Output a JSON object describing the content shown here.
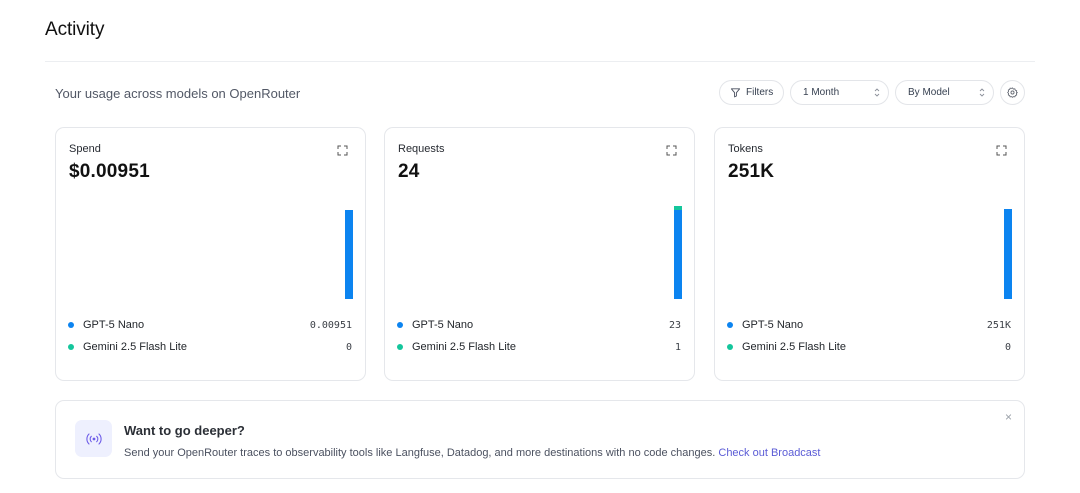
{
  "header": {
    "title": "Activity"
  },
  "subtitle": "Your usage across models on OpenRouter",
  "toolbar": {
    "filters_label": "Filters",
    "period_value": "1 Month",
    "group_value": "By Model"
  },
  "legend_colors": {
    "gpt5_nano": "#0c84f0",
    "gemini_flash_lite": "#14c69c"
  },
  "cards": [
    {
      "label": "Spend",
      "value": "$0.00951",
      "rows": [
        {
          "name": "GPT-5 Nano",
          "value": "0.00951"
        },
        {
          "name": "Gemini 2.5 Flash Lite",
          "value": "0"
        }
      ]
    },
    {
      "label": "Requests",
      "value": "24",
      "rows": [
        {
          "name": "GPT-5 Nano",
          "value": "23"
        },
        {
          "name": "Gemini 2.5 Flash Lite",
          "value": "1"
        }
      ]
    },
    {
      "label": "Tokens",
      "value": "251K",
      "rows": [
        {
          "name": "GPT-5 Nano",
          "value": "251K"
        },
        {
          "name": "Gemini 2.5 Flash Lite",
          "value": "0"
        }
      ]
    }
  ],
  "banner": {
    "heading": "Want to go deeper?",
    "text": "Send your OpenRouter traces to observability tools like Langfuse, Datadog, and more destinations with no code changes.",
    "link": "Check out Broadcast",
    "close": "×"
  },
  "icons": {
    "filter": "filter-icon",
    "expand": "expand-icon",
    "gear": "gear-icon",
    "broadcast": "broadcast-icon"
  }
}
